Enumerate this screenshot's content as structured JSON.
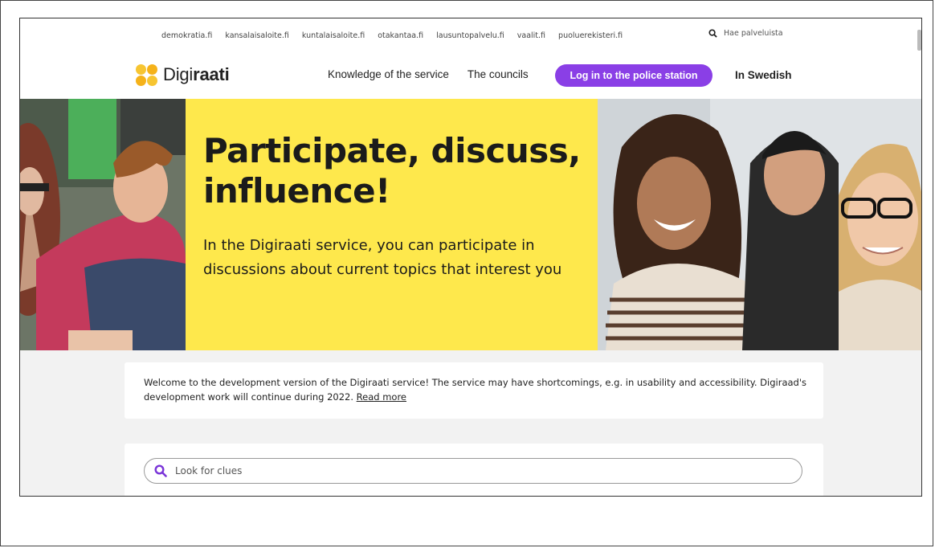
{
  "top_links": [
    "demokratia.fi",
    "kansalaisaloite.fi",
    "kuntalaisaloite.fi",
    "otakantaa.fi",
    "lausuntopalvelu.fi",
    "vaalit.fi",
    "puoluerekisteri.fi"
  ],
  "top_search_label": "Hae palveluista",
  "logo": {
    "prefix": "Digi",
    "suffix": "raati"
  },
  "nav": {
    "knowledge": "Knowledge of the service",
    "councils": "The councils",
    "login": "Log in to the police station",
    "swedish": "In Swedish"
  },
  "hero": {
    "title": "Participate, discuss, influence!",
    "subtitle": "In the Digiraati service, you can participate in discussions about current topics that interest you"
  },
  "notice": {
    "text": "Welcome to the development version of the Digiraati service! The service may have shortcomings, e.g. in usability and accessibility. Digiraad's development work will continue during 2022.",
    "link": "Read more"
  },
  "search": {
    "placeholder": "Look for clues"
  },
  "colors": {
    "accent": "#8a3fe6",
    "hero_yellow": "#fee84c",
    "logo_yellow": "#f5b21a"
  }
}
